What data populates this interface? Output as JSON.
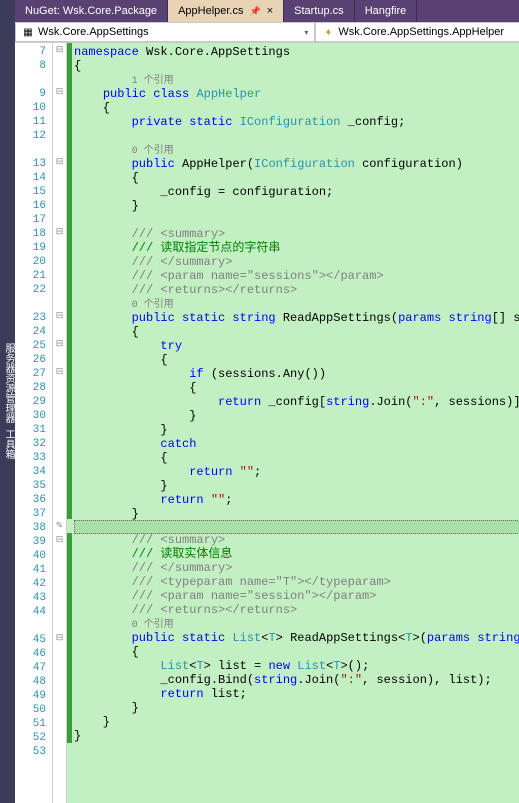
{
  "sidebar": {
    "text": "服务器资源管理器  工具箱"
  },
  "tabs": [
    {
      "label": "NuGet: Wsk.Core.Package",
      "active": false
    },
    {
      "label": "AppHelper.cs",
      "active": true,
      "pinned": true
    },
    {
      "label": "Startup.cs",
      "active": false
    },
    {
      "label": "Hangfire",
      "active": false
    }
  ],
  "nav": {
    "left": "Wsk.Core.AppSettings",
    "right": "Wsk.Core.AppSettings.AppHelper"
  },
  "code": {
    "lines": [
      {
        "n": 7,
        "cb": "green",
        "mk": "⊟",
        "html": "<span class='kw'>namespace</span> <span class='ident'>Wsk.Core.AppSettings</span>"
      },
      {
        "n": 8,
        "cb": "green",
        "mk": "",
        "html": "{",
        "ref_below": "1 个引用"
      },
      {
        "n": 9,
        "cb": "green",
        "mk": "⊟",
        "html": "    <span class='kw'>public class</span> <span class='type'>AppHelper</span>"
      },
      {
        "n": 10,
        "cb": "green",
        "mk": "",
        "html": "    {"
      },
      {
        "n": 11,
        "cb": "green",
        "mk": "",
        "html": "        <span class='kw'>private static</span> <span class='type'>IConfiguration</span> <span class='ident'>_config</span>;"
      },
      {
        "n": 12,
        "cb": "green",
        "mk": "",
        "html": "",
        "ref_below": "0 个引用"
      },
      {
        "n": 13,
        "cb": "green",
        "mk": "⊟",
        "html": "        <span class='kw'>public</span> <span class='ident'>AppHelper</span>(<span class='type'>IConfiguration</span> configuration)"
      },
      {
        "n": 14,
        "cb": "green",
        "mk": "",
        "html": "        {"
      },
      {
        "n": 15,
        "cb": "green",
        "mk": "",
        "html": "            _config = configuration;"
      },
      {
        "n": 16,
        "cb": "green",
        "mk": "",
        "html": "        }"
      },
      {
        "n": 17,
        "cb": "green",
        "mk": "",
        "html": ""
      },
      {
        "n": 18,
        "cb": "green",
        "mk": "⊟",
        "html": "        <span class='xmlcmt'>/// &lt;summary&gt;</span>"
      },
      {
        "n": 19,
        "cb": "green",
        "mk": "",
        "html": "        <span class='cmt'>/// 读取指定节点的字符串</span>"
      },
      {
        "n": 20,
        "cb": "green",
        "mk": "",
        "html": "        <span class='xmlcmt'>/// &lt;/summary&gt;</span>"
      },
      {
        "n": 21,
        "cb": "green",
        "mk": "",
        "html": "        <span class='xmlcmt'>/// &lt;param name=\"sessions\"&gt;&lt;/param&gt;</span>"
      },
      {
        "n": 22,
        "cb": "green",
        "mk": "",
        "html": "        <span class='xmlcmt'>/// &lt;returns&gt;&lt;/returns&gt;</span>",
        "ref_below": "0 个引用"
      },
      {
        "n": 23,
        "cb": "green",
        "mk": "⊟",
        "html": "        <span class='kw'>public static string</span> <span class='method'>ReadAppSettings</span>(<span class='kw'>params string</span>[] sessions)"
      },
      {
        "n": 24,
        "cb": "green",
        "mk": "",
        "html": "        {"
      },
      {
        "n": 25,
        "cb": "green",
        "mk": "⊟",
        "html": "            <span class='kw'>try</span>"
      },
      {
        "n": 26,
        "cb": "green",
        "mk": "",
        "html": "            {"
      },
      {
        "n": 27,
        "cb": "green",
        "mk": "⊟",
        "html": "                <span class='kw'>if</span> (sessions.Any())"
      },
      {
        "n": 28,
        "cb": "green",
        "mk": "",
        "html": "                {"
      },
      {
        "n": 29,
        "cb": "green",
        "mk": "",
        "html": "                    <span class='kw'>return</span> _config[<span class='kw'>string</span>.Join(<span class='str'>\":\"</span>, sessions)];"
      },
      {
        "n": 30,
        "cb": "green",
        "mk": "",
        "html": "                }"
      },
      {
        "n": 31,
        "cb": "green",
        "mk": "",
        "html": "            }"
      },
      {
        "n": 32,
        "cb": "green",
        "mk": "",
        "html": "            <span class='kw'>catch</span>"
      },
      {
        "n": 33,
        "cb": "green",
        "mk": "",
        "html": "            {"
      },
      {
        "n": 34,
        "cb": "green",
        "mk": "",
        "html": "                <span class='kw'>return</span> <span class='str'>\"\"</span>;"
      },
      {
        "n": 35,
        "cb": "green",
        "mk": "",
        "html": "            }"
      },
      {
        "n": 36,
        "cb": "green",
        "mk": "",
        "html": "            <span class='kw'>return</span> <span class='str'>\"\"</span>;"
      },
      {
        "n": 37,
        "cb": "green",
        "mk": "",
        "html": "        }"
      },
      {
        "n": 38,
        "cb": "",
        "mk": "✎",
        "html": "",
        "hl": true
      },
      {
        "n": 39,
        "cb": "green",
        "mk": "⊟",
        "html": "        <span class='xmlcmt'>/// &lt;summary&gt;</span>"
      },
      {
        "n": 40,
        "cb": "green",
        "mk": "",
        "html": "        <span class='cmt'>/// 读取实体信息</span>"
      },
      {
        "n": 41,
        "cb": "green",
        "mk": "",
        "html": "        <span class='xmlcmt'>/// &lt;/summary&gt;</span>"
      },
      {
        "n": 42,
        "cb": "green",
        "mk": "",
        "html": "        <span class='xmlcmt'>/// &lt;typeparam name=\"T\"&gt;&lt;/typeparam&gt;</span>"
      },
      {
        "n": 43,
        "cb": "green",
        "mk": "",
        "html": "        <span class='xmlcmt'>/// &lt;param name=\"session\"&gt;&lt;/param&gt;</span>"
      },
      {
        "n": 44,
        "cb": "green",
        "mk": "",
        "html": "        <span class='xmlcmt'>/// &lt;returns&gt;&lt;/returns&gt;</span>",
        "ref_below": "0 个引用"
      },
      {
        "n": 45,
        "cb": "green",
        "mk": "⊟",
        "html": "        <span class='kw'>public static</span> <span class='type'>List</span>&lt;<span class='type'>T</span>&gt; <span class='method'>ReadAppSettings</span>&lt;<span class='type'>T</span>&gt;(<span class='kw'>params string</span>[] session)"
      },
      {
        "n": 46,
        "cb": "green",
        "mk": "",
        "html": "        {"
      },
      {
        "n": 47,
        "cb": "green",
        "mk": "",
        "html": "            <span class='type'>List</span>&lt;<span class='type'>T</span>&gt; list = <span class='kw'>new</span> <span class='type'>List</span>&lt;<span class='type'>T</span>&gt;();"
      },
      {
        "n": 48,
        "cb": "green",
        "mk": "",
        "html": "            _config.Bind(<span class='kw'>string</span>.Join(<span class='str'>\":\"</span>, session), list);"
      },
      {
        "n": 49,
        "cb": "green",
        "mk": "",
        "html": "            <span class='kw'>return</span> list;"
      },
      {
        "n": 50,
        "cb": "green",
        "mk": "",
        "html": "        }"
      },
      {
        "n": 51,
        "cb": "green",
        "mk": "",
        "html": "    }"
      },
      {
        "n": 52,
        "cb": "green",
        "mk": "",
        "html": "}"
      },
      {
        "n": 53,
        "cb": "",
        "mk": "",
        "html": ""
      }
    ]
  }
}
